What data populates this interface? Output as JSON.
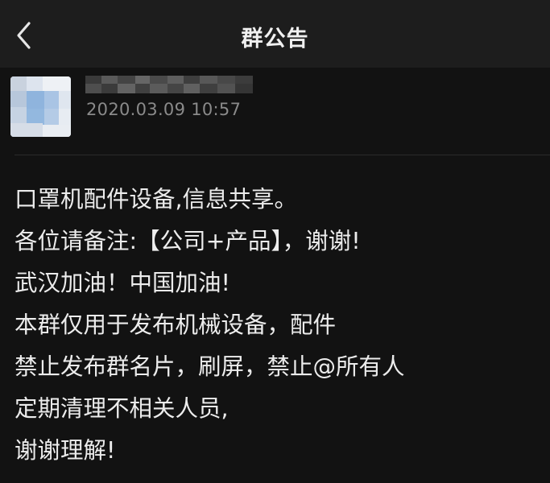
{
  "header": {
    "title": "群公告",
    "back_icon": "chevron-left-icon"
  },
  "author": {
    "name": "",
    "avatar_icon": "pixelated-avatar",
    "timestamp": "2020.03.09  10:57"
  },
  "announcement": {
    "lines": [
      "口罩机配件设备,信息共享。",
      "各位请备注:【公司+产品】，谢谢!",
      "武汉加油！中国加油!",
      "本群仅用于发布机械设备，配件",
      "禁止发布群名片，刷屏，禁止@所有人",
      "定期清理不相关人员,",
      "谢谢理解!"
    ]
  },
  "colors": {
    "background": "#121212",
    "nav_background": "#1d1d1d",
    "text": "#ececec",
    "timestamp": "#8a8a8a"
  }
}
